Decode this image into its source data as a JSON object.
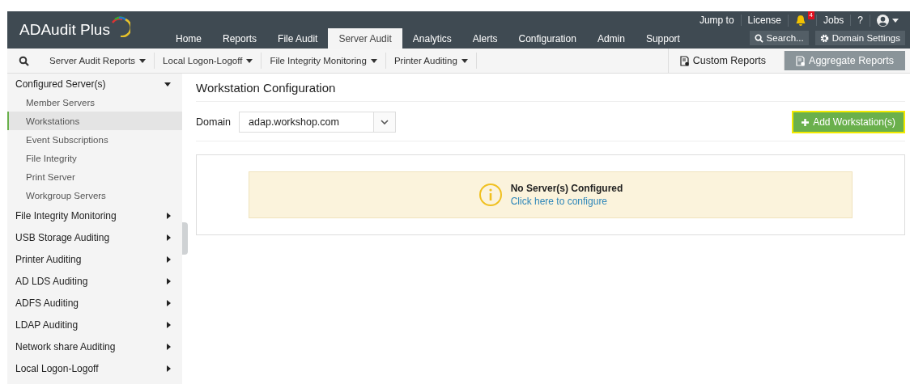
{
  "app": {
    "logo": "ADAudit Plus"
  },
  "top_links": [
    {
      "kind": "link",
      "label": "Jump to"
    },
    {
      "kind": "link",
      "label": "License"
    },
    {
      "kind": "bell",
      "badge": "4"
    },
    {
      "kind": "link",
      "label": "Jobs"
    },
    {
      "kind": "link",
      "label": "?"
    },
    {
      "kind": "user"
    }
  ],
  "tabs": [
    {
      "label": "Home",
      "selected": false
    },
    {
      "label": "Reports",
      "selected": false
    },
    {
      "label": "File Audit",
      "selected": false
    },
    {
      "label": "Server Audit",
      "selected": true
    },
    {
      "label": "Analytics",
      "selected": false
    },
    {
      "label": "Alerts",
      "selected": false
    },
    {
      "label": "Configuration",
      "selected": false
    },
    {
      "label": "Admin",
      "selected": false
    },
    {
      "label": "Support",
      "selected": false
    }
  ],
  "header_buttons": [
    {
      "kind": "search",
      "label": "Search..."
    },
    {
      "kind": "settings",
      "label": "Domain Settings"
    }
  ],
  "subnav": {
    "menus": [
      "Server Audit Reports",
      "Local Logon-Logoff",
      "File Integrity Monitoring",
      "Printer Auditing"
    ],
    "report_buttons": [
      {
        "label": "Custom Reports",
        "selected": false
      },
      {
        "label": "Aggregate Reports",
        "selected": true
      }
    ]
  },
  "sidebar": {
    "items": [
      {
        "label": "Configured Server(s)",
        "expanded": true,
        "children": [
          {
            "label": "Member Servers",
            "selected": false
          },
          {
            "label": "Workstations",
            "selected": true
          },
          {
            "label": "Event Subscriptions",
            "selected": false
          },
          {
            "label": "File Integrity",
            "selected": false
          },
          {
            "label": "Print Server",
            "selected": false
          },
          {
            "label": "Workgroup Servers",
            "selected": false
          }
        ]
      },
      {
        "label": "File Integrity Monitoring",
        "expanded": false
      },
      {
        "label": "USB Storage Auditing",
        "expanded": false
      },
      {
        "label": "Printer Auditing",
        "expanded": false
      },
      {
        "label": "AD LDS Auditing",
        "expanded": false
      },
      {
        "label": "ADFS Auditing",
        "expanded": false
      },
      {
        "label": "LDAP Auditing",
        "expanded": false
      },
      {
        "label": "Network share Auditing",
        "expanded": false
      },
      {
        "label": "Local Logon-Logoff",
        "expanded": false
      }
    ]
  },
  "content": {
    "title": "Workstation Configuration",
    "domain": {
      "label": "Domain",
      "value": "adap.workshop.com"
    },
    "add_button": {
      "label": "Add Workstation(s)",
      "highlighted": true
    },
    "notice": {
      "title": "No Server(s) Configured",
      "link": "Click here to configure"
    }
  }
}
